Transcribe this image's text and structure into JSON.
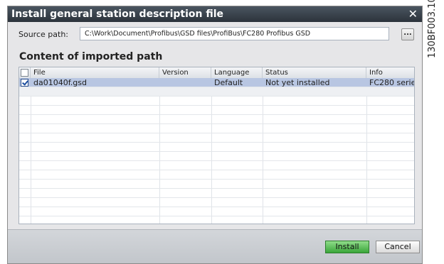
{
  "dialog": {
    "title": "Install general station description file",
    "close_glyph": "✕"
  },
  "source": {
    "label": "Source path:",
    "path": "C:\\Work\\Document\\Profibus\\GSD files\\ProfiBus\\FC280 Profibus GSD",
    "browse_label": "..."
  },
  "content": {
    "title": "Content of imported path",
    "columns": [
      "File",
      "Version",
      "Language",
      "Status",
      "Info"
    ],
    "select_all_checked": false,
    "rows": [
      {
        "checked": true,
        "file": "da01040f.gsd",
        "version": "",
        "language": "Default",
        "status": "Not yet installed",
        "info": "FC280 serie..."
      }
    ]
  },
  "footer": {
    "install_label": "Install",
    "cancel_label": "Cancel"
  },
  "side_code": "130BF003.10",
  "colors": {
    "titlebar": "#2c333b",
    "selected_row": "#b8c6e2",
    "install_button": "#3aa63a"
  }
}
